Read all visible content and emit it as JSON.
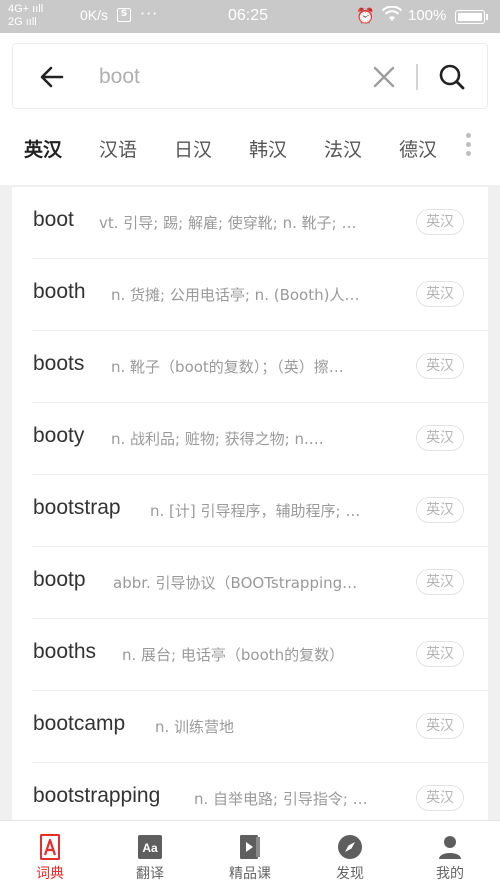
{
  "status_bar": {
    "signal_top": "4G+",
    "signal_bottom": "2G",
    "net_speed": "0K/s",
    "notif_glyph": "S",
    "more": "···",
    "time": "06:25",
    "alarm_icon": "alarm-icon",
    "wifi_icon": "wifi-icon",
    "battery_pct": "100%"
  },
  "search": {
    "value": "boot",
    "back_icon": "arrow-left-icon",
    "clear_icon": "close-icon",
    "search_icon": "search-icon"
  },
  "lang_tabs": [
    {
      "label": "英汉",
      "active": true
    },
    {
      "label": "汉语",
      "active": false
    },
    {
      "label": "日汉",
      "active": false
    },
    {
      "label": "韩汉",
      "active": false
    },
    {
      "label": "法汉",
      "active": false
    },
    {
      "label": "德汉",
      "active": false
    }
  ],
  "results": [
    {
      "word": "boot",
      "def": "vt. 引导; 踢; 解雇; 使穿靴; n. 靴子; …",
      "badge": "英汉"
    },
    {
      "word": "booth",
      "def": "n. 货摊; 公用电话亭; n. (Booth)人…",
      "badge": "英汉"
    },
    {
      "word": "boots",
      "def": "n. 靴子（boot的复数）；（英）擦…",
      "badge": "英汉"
    },
    {
      "word": "booty",
      "def": "n. 战利品; 赃物; 获得之物; n.…",
      "badge": "英汉"
    },
    {
      "word": "bootstrap",
      "def": "n. [计] 引导程序，辅助程序; …",
      "badge": "英汉"
    },
    {
      "word": "bootp",
      "def": "abbr. 引导协议（BOOTstrapping…",
      "badge": "英汉"
    },
    {
      "word": "booths",
      "def": "n. 展台; 电话亭（booth的复数）",
      "badge": "英汉"
    },
    {
      "word": "bootcamp",
      "def": "n. 训练营地",
      "badge": "英汉"
    },
    {
      "word": "bootstrapping",
      "def": "n. 自举电路; 引导指令; …",
      "badge": "英汉"
    }
  ],
  "bottom_nav": [
    {
      "label": "词典",
      "icon": "dictionary-icon",
      "active": true
    },
    {
      "label": "翻译",
      "icon": "translate-icon",
      "active": false
    },
    {
      "label": "精品课",
      "icon": "course-icon",
      "active": false
    },
    {
      "label": "发现",
      "icon": "compass-icon",
      "active": false
    },
    {
      "label": "我的",
      "icon": "profile-icon",
      "active": false
    }
  ],
  "colors": {
    "accent": "#e52e2e",
    "status_bar": "#c9c9c9",
    "text_primary": "#333333",
    "text_secondary": "#9a9a9a"
  }
}
